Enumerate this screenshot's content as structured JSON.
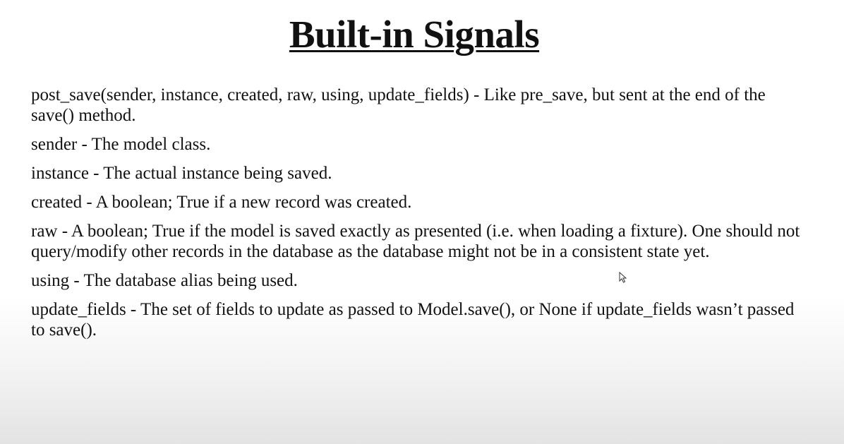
{
  "slide": {
    "title": "Built-in Signals",
    "paragraphs": [
      "post_save(sender, instance, created, raw, using, update_fields) - Like pre_save, but sent at the end of the save() method.",
      "sender - The model class.",
      "instance - The actual instance being saved.",
      "created - A boolean; True if a new record was created.",
      "raw - A boolean; True if the model is saved exactly as presented (i.e. when loading a fixture). One should not query/modify other records in the database as the database might not be in a consistent state yet.",
      "using - The database alias being used.",
      "update_fields - The set of fields to update as passed to Model.save(), or None if update_fields wasn’t passed to save()."
    ]
  },
  "cursor_icon": "mouse-pointer-icon"
}
